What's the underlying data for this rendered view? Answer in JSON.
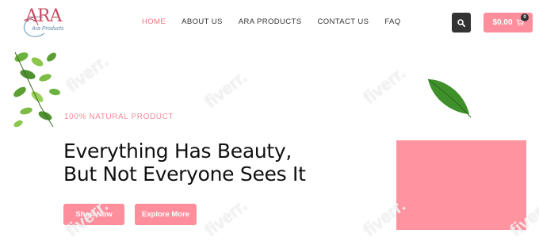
{
  "brand": {
    "logo_text": "ARA",
    "logo_script": "Ara Products"
  },
  "nav": {
    "items": [
      {
        "label": "HOME",
        "active": true
      },
      {
        "label": "ABOUT US",
        "active": false
      },
      {
        "label": "ARA PRODUCTS",
        "active": false
      },
      {
        "label": "CONTACT US",
        "active": false
      },
      {
        "label": "FAQ",
        "active": false
      }
    ]
  },
  "header": {
    "cart_total": "$0.00",
    "cart_count": "0"
  },
  "hero": {
    "eyebrow": "100% NATURAL PRODUCT",
    "headline_line1": "Everything Has Beauty,",
    "headline_line2": "But Not Everyone Sees It",
    "shop_label": "Shop Now",
    "explore_label": "Explore More"
  },
  "watermark": {
    "text": "fiverr."
  },
  "colors": {
    "accent": "#ff8e9c",
    "nav_active": "#f07483",
    "dark": "#333333",
    "leaf": "#5fa83a"
  },
  "icons": {
    "search": "search-icon",
    "cart": "cart-icon"
  }
}
